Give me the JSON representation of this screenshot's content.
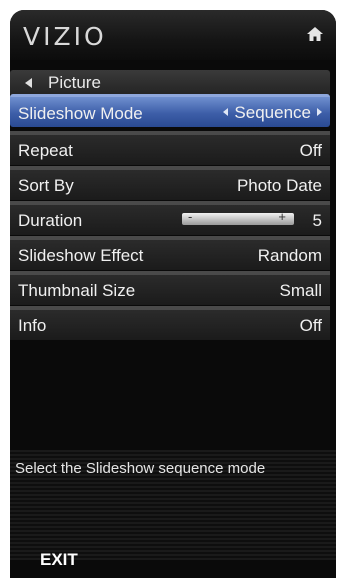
{
  "header": {
    "logo": "VIZIO",
    "home_icon": "home-icon"
  },
  "nav": {
    "back_label": "Picture"
  },
  "menu": {
    "items": [
      {
        "label": "Slideshow Mode",
        "value": "Sequence",
        "selected": true
      },
      {
        "label": "Repeat",
        "value": "Off"
      },
      {
        "label": "Sort By",
        "value": "Photo Date"
      },
      {
        "label": "Duration",
        "value": "5",
        "slider_min_symbol": "-",
        "slider_plus_symbol": "+"
      },
      {
        "label": "Slideshow Effect",
        "value": "Random"
      },
      {
        "label": "Thumbnail Size",
        "value": "Small"
      },
      {
        "label": "Info",
        "value": "Off"
      }
    ]
  },
  "help": {
    "text": "Select the Slideshow sequence mode"
  },
  "footer": {
    "exit_label": "EXIT"
  },
  "colors": {
    "selected_row": "#3d5ea8",
    "panel": "#0a0a0a"
  }
}
